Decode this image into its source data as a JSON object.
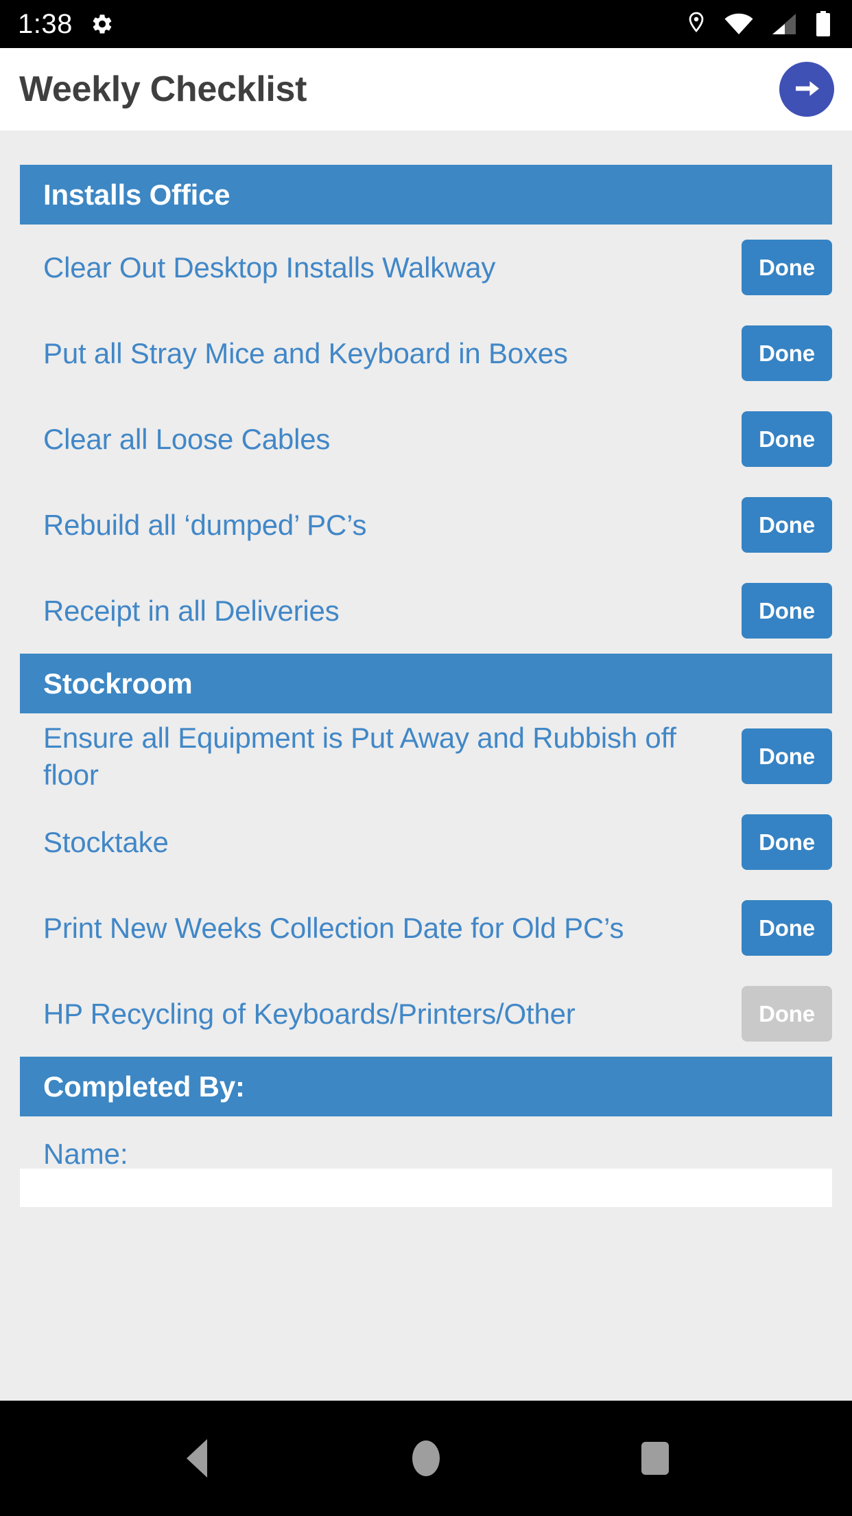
{
  "status_bar": {
    "time": "1:38",
    "icons": [
      "gear-icon",
      "location-icon",
      "wifi-icon",
      "cellular-signal-icon",
      "battery-icon"
    ]
  },
  "app_bar": {
    "title": "Weekly Checklist",
    "next_button_icon": "arrow-right-icon"
  },
  "colors": {
    "section_header_bg": "#3c87c4",
    "link_blue": "#4187c7",
    "done_button_bg": "#3583c4",
    "done_button_disabled_bg": "#c9c9c9",
    "fab_bg": "#3f51b5",
    "page_bg": "#ededed",
    "appbar_bg": "#ffffff",
    "title_color": "#3f3f3f"
  },
  "sections": [
    {
      "title": "Installs Office",
      "tasks": [
        {
          "label": "Clear Out Desktop Installs Walkway",
          "button": "Done",
          "state": "enabled"
        },
        {
          "label": "Put all Stray Mice and Keyboard in Boxes",
          "button": "Done",
          "state": "enabled"
        },
        {
          "label": "Clear all Loose Cables",
          "button": "Done",
          "state": "enabled"
        },
        {
          "label": "Rebuild all ‘dumped’ PC’s",
          "button": "Done",
          "state": "enabled"
        },
        {
          "label": "Receipt in all Deliveries",
          "button": "Done",
          "state": "enabled"
        }
      ]
    },
    {
      "title": "Stockroom",
      "tasks": [
        {
          "label": "Ensure all Equipment is Put Away and Rubbish off floor",
          "button": "Done",
          "state": "enabled"
        },
        {
          "label": "Stocktake",
          "button": "Done",
          "state": "enabled"
        },
        {
          "label": "Print New Weeks Collection Date for Old PC’s",
          "button": "Done",
          "state": "enabled"
        },
        {
          "label": "HP Recycling of Keyboards/Printers/Other",
          "button": "Done",
          "state": "disabled"
        }
      ]
    }
  ],
  "footer": {
    "section_title": "Completed By:",
    "name_label": "Name:",
    "name_value": "",
    "name_placeholder": ""
  },
  "nav_bar": {
    "back": "back-icon",
    "home": "home-icon",
    "recents": "recents-icon"
  }
}
